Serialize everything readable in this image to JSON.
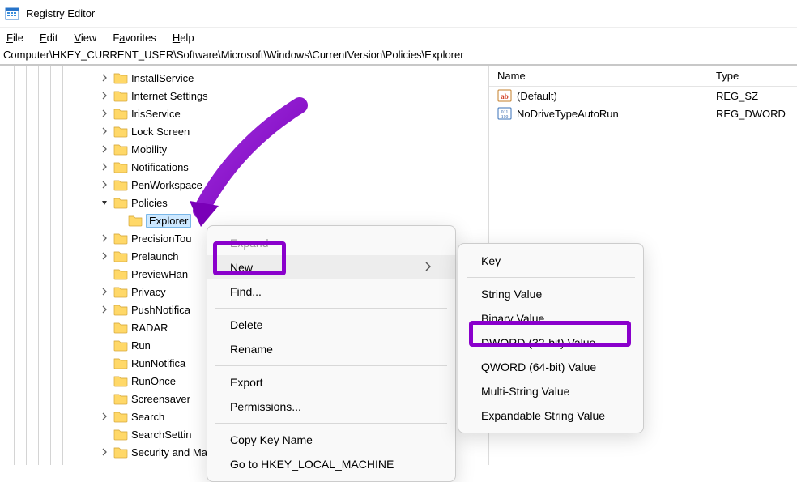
{
  "titlebar": {
    "title": "Registry Editor"
  },
  "menubar": {
    "file": "File",
    "edit": "Edit",
    "view": "View",
    "favorites": "Favorites",
    "help": "Help"
  },
  "addressbar": "Computer\\HKEY_CURRENT_USER\\Software\\Microsoft\\Windows\\CurrentVersion\\Policies\\Explorer",
  "tree": {
    "items": [
      {
        "label": "InstallService",
        "exp": "closed",
        "indent": 1
      },
      {
        "label": "Internet Settings",
        "exp": "closed",
        "indent": 1
      },
      {
        "label": "IrisService",
        "exp": "closed",
        "indent": 1
      },
      {
        "label": "Lock Screen",
        "exp": "closed",
        "indent": 1
      },
      {
        "label": "Mobility",
        "exp": "closed",
        "indent": 1
      },
      {
        "label": "Notifications",
        "exp": "closed",
        "indent": 1
      },
      {
        "label": "PenWorkspace",
        "exp": "closed",
        "indent": 1
      },
      {
        "label": "Policies",
        "exp": "open",
        "indent": 1
      },
      {
        "label": "Explorer",
        "exp": "none",
        "indent": 2,
        "selected": true
      },
      {
        "label": "PrecisionTou",
        "exp": "closed",
        "indent": 1
      },
      {
        "label": "Prelaunch",
        "exp": "closed",
        "indent": 1
      },
      {
        "label": "PreviewHan",
        "exp": "none",
        "indent": 1
      },
      {
        "label": "Privacy",
        "exp": "closed",
        "indent": 1
      },
      {
        "label": "PushNotifica",
        "exp": "closed",
        "indent": 1
      },
      {
        "label": "RADAR",
        "exp": "none",
        "indent": 1
      },
      {
        "label": "Run",
        "exp": "none",
        "indent": 1
      },
      {
        "label": "RunNotifica",
        "exp": "none",
        "indent": 1
      },
      {
        "label": "RunOnce",
        "exp": "none",
        "indent": 1
      },
      {
        "label": "Screensaver",
        "exp": "none",
        "indent": 1
      },
      {
        "label": "Search",
        "exp": "closed",
        "indent": 1
      },
      {
        "label": "SearchSettin",
        "exp": "none",
        "indent": 1
      },
      {
        "label": "Security and Maintenance",
        "exp": "closed",
        "indent": 1
      }
    ]
  },
  "list": {
    "cols": {
      "name": "Name",
      "type": "Type"
    },
    "rows": [
      {
        "name": "(Default)",
        "type": "REG_SZ",
        "icon": "string"
      },
      {
        "name": "NoDriveTypeAutoRun",
        "type": "REG_DWORD",
        "icon": "binary"
      }
    ]
  },
  "context1": {
    "expand": "Expand",
    "new": "New",
    "find": "Find...",
    "delete": "Delete",
    "rename": "Rename",
    "export": "Export",
    "permissions": "Permissions...",
    "copykey": "Copy Key Name",
    "goto": "Go to HKEY_LOCAL_MACHINE"
  },
  "context2": {
    "key": "Key",
    "string": "String Value",
    "binary": "Binary Value",
    "dword": "DWORD (32-bit) Value",
    "qword": "QWORD (64-bit) Value",
    "multi": "Multi-String Value",
    "expand": "Expandable String Value"
  }
}
